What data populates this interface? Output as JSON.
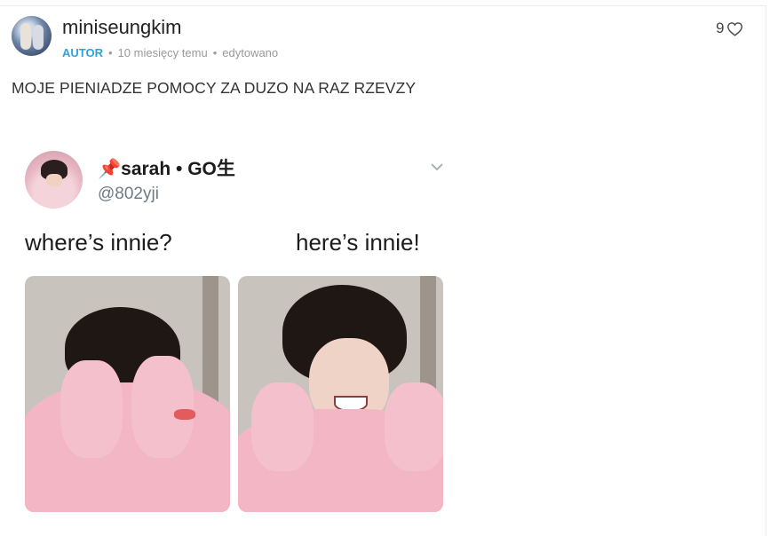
{
  "post": {
    "username": "miniseungkim",
    "author_badge": "AUTOR",
    "time": "10 miesięcy temu",
    "edited": "edytowano",
    "separator": "•",
    "like_count": "9",
    "comment": "MOJE PIENIADZE POMOCY ZA DUZO NA RAZ RZEVZY"
  },
  "tweet": {
    "display_name": "📌sarah • GO生",
    "handle": "@802yji",
    "caption_left": "where’s innie?",
    "caption_right": "here’s innie!"
  },
  "icons": {
    "like": "heart-outline-icon",
    "menu": "chevron-down-icon"
  },
  "colors": {
    "author_accent": "#2da3d9",
    "hoodie_pink": "#f2b6c4"
  }
}
